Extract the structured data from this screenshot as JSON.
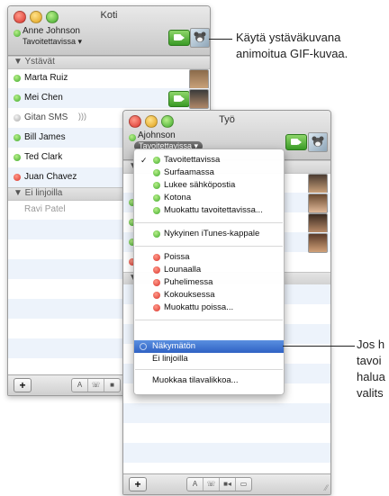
{
  "koti_window": {
    "title": "Koti",
    "me_name": "Anne Johnson",
    "me_status": "Tavoitettavissa ▾",
    "groups": [
      {
        "label": "▼ Ystävät"
      },
      {
        "label": "▼ Ei linjoilla"
      }
    ],
    "buddies": [
      {
        "name": "Marta Ruiz",
        "status": "green"
      },
      {
        "name": "Mei Chen",
        "status": "green"
      },
      {
        "name": "Gitan SMS",
        "status": "gray"
      },
      {
        "name": "Bill James",
        "status": "green"
      },
      {
        "name": "Ted Clark",
        "status": "green"
      },
      {
        "name": "Juan Chavez",
        "status": "red"
      }
    ],
    "offline": [
      {
        "name": "Ravi Patel"
      }
    ],
    "toolbar": {
      "plus": "+",
      "seg": [
        "A",
        "☏",
        "■"
      ]
    }
  },
  "tyo_window": {
    "title": "Työ",
    "me_name": "Ajohnson",
    "me_status": "Tavoitettavissa ▾",
    "toolbar": {
      "plus": "+",
      "seg": [
        "A",
        "☏",
        "■◂",
        "▭"
      ]
    }
  },
  "status_menu": {
    "check_mark": "✓",
    "available": [
      {
        "label": "Tavoitettavissa",
        "checked": true
      },
      {
        "label": "Surfaamassa"
      },
      {
        "label": "Lukee sähköpostia"
      },
      {
        "label": "Kotona"
      },
      {
        "label": "Muokattu tavoitettavissa..."
      }
    ],
    "itunes": {
      "label": "Nykyinen iTunes-kappale"
    },
    "away": [
      {
        "label": "Poissa"
      },
      {
        "label": "Lounaalla"
      },
      {
        "label": "Puhelimessa"
      },
      {
        "label": "Kokouksessa"
      },
      {
        "label": "Muokattu poissa..."
      }
    ],
    "invisible": {
      "label": "Näkymätön"
    },
    "offline": {
      "label": "Ei linjoilla"
    },
    "edit": {
      "label": "Muokkaa tilavalikkoa..."
    }
  },
  "callouts": {
    "top_line1": "Käytä ystäväkuvana",
    "top_line2": "animoitua GIF-kuvaa.",
    "right_line1": "Jos h",
    "right_line2": "tavoi",
    "right_line3": "halua",
    "right_line4": "valits"
  },
  "colors": {
    "selection": "#2f62c4",
    "status_green": "#3ea82a",
    "status_red": "#d9322a",
    "row_alt": "#edf3fb"
  }
}
